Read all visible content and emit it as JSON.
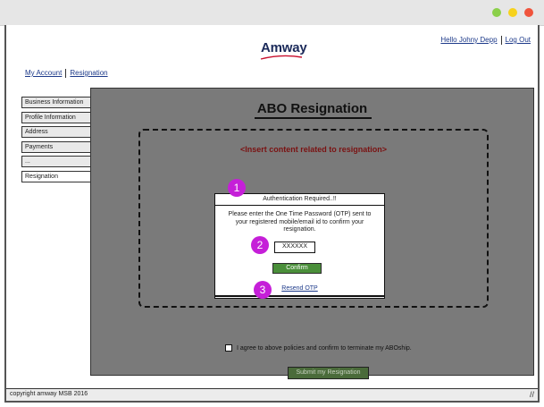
{
  "window": {
    "controls": [
      {
        "name": "minimize",
        "color": "#8bd04a"
      },
      {
        "name": "maximize",
        "color": "#f7d21c"
      },
      {
        "name": "close",
        "color": "#f0543c"
      }
    ]
  },
  "header": {
    "logo_text": "Amway",
    "greeting": "Hello Johny Depp",
    "logout": "Log Out"
  },
  "breadcrumb": {
    "items": [
      "My Account",
      "Resignation"
    ]
  },
  "sidebar": {
    "items": [
      {
        "label": "Business Information",
        "active": false
      },
      {
        "label": "Profile Information",
        "active": false
      },
      {
        "label": "Address",
        "active": false
      },
      {
        "label": "Payments",
        "active": false
      },
      {
        "label": "...",
        "active": false
      },
      {
        "label": "Resignation",
        "active": true
      }
    ]
  },
  "main": {
    "title": "ABO Resignation",
    "placeholder": "<Insert content related to resignation>",
    "agree_text": "I agree to above policies and confirm to terminate my ABOship.",
    "submit_label": "Submit my Resignation"
  },
  "modal": {
    "header": "Authentication Required..!!",
    "body": "Please enter the One Time Password (OTP) sent to your registered mobile/email id to confirm your resignation.",
    "otp_value": "XXXXXX",
    "confirm_label": "Confirm",
    "resend_label": "Resend OTP"
  },
  "badges": [
    "1",
    "2",
    "3"
  ],
  "footer": {
    "copyright": "copyright amway MSB 2016"
  },
  "colors": {
    "panel": "#7a7a7a",
    "accent_green": "#4a8f3a",
    "badge": "#c51fd8",
    "placeholder_text": "#7a1212"
  }
}
